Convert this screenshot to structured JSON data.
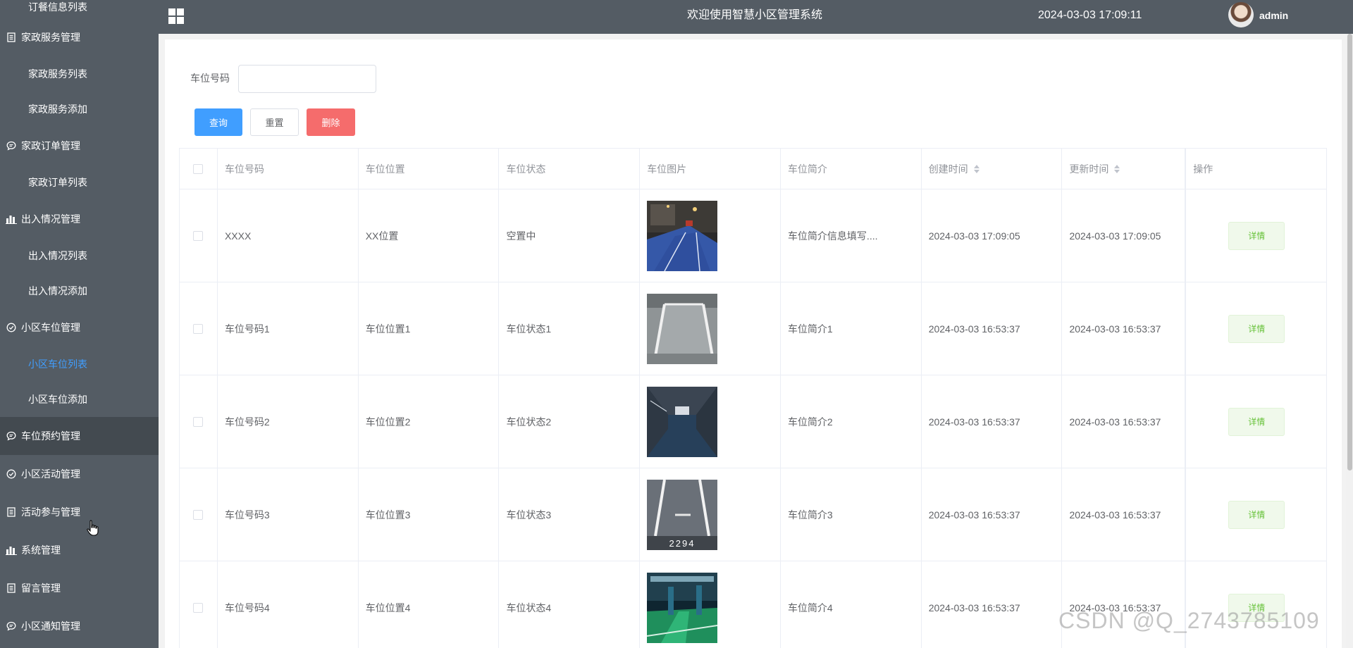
{
  "header": {
    "title": "欢迎使用智慧小区管理系统",
    "datetime": "2024-03-03 17:09:11",
    "username": "admin"
  },
  "sidebar": {
    "entries": [
      {
        "type": "item",
        "label": "订餐信息列表"
      },
      {
        "type": "group",
        "label": "家政服务管理",
        "icon": "document-icon"
      },
      {
        "type": "item",
        "label": "家政服务列表"
      },
      {
        "type": "item",
        "label": "家政服务添加"
      },
      {
        "type": "group",
        "label": "家政订单管理",
        "icon": "chat-icon"
      },
      {
        "type": "item",
        "label": "家政订单列表"
      },
      {
        "type": "group",
        "label": "出入情况管理",
        "icon": "bar-chart-icon"
      },
      {
        "type": "item",
        "label": "出入情况列表"
      },
      {
        "type": "item",
        "label": "出入情况添加"
      },
      {
        "type": "group",
        "label": "小区车位管理",
        "icon": "check-circle-icon"
      },
      {
        "type": "item",
        "label": "小区车位列表",
        "active": true
      },
      {
        "type": "item",
        "label": "小区车位添加"
      },
      {
        "type": "group",
        "label": "车位预约管理",
        "icon": "chat-icon",
        "highlight": true
      },
      {
        "type": "group",
        "label": "小区活动管理",
        "icon": "check-circle-icon"
      },
      {
        "type": "group",
        "label": "活动参与管理",
        "icon": "document-icon"
      },
      {
        "type": "group",
        "label": "系统管理",
        "icon": "bar-chart-icon"
      },
      {
        "type": "group",
        "label": "留言管理",
        "icon": "document-icon"
      },
      {
        "type": "group",
        "label": "小区通知管理",
        "icon": "chat-icon"
      }
    ]
  },
  "search": {
    "label": "车位号码",
    "value": "",
    "placeholder": ""
  },
  "buttons": {
    "query": "查询",
    "reset": "重置",
    "delete": "删除"
  },
  "table": {
    "columns": [
      "车位号码",
      "车位位置",
      "车位状态",
      "车位图片",
      "车位简介",
      "创建时间",
      "更新时间",
      "操作"
    ],
    "rows": [
      {
        "number": "XXXX",
        "location": "XX位置",
        "status": "空置中",
        "image": "parking-photo-1",
        "intro": "车位简介信息填写....",
        "created": "2024-03-03 17:09:05",
        "updated": "2024-03-03 17:09:05",
        "action": "详情"
      },
      {
        "number": "车位号码1",
        "location": "车位位置1",
        "status": "车位状态1",
        "image": "parking-photo-2",
        "intro": "车位简介1",
        "created": "2024-03-03 16:53:37",
        "updated": "2024-03-03 16:53:37",
        "action": "详情"
      },
      {
        "number": "车位号码2",
        "location": "车位位置2",
        "status": "车位状态2",
        "image": "parking-photo-3",
        "intro": "车位简介2",
        "created": "2024-03-03 16:53:37",
        "updated": "2024-03-03 16:53:37",
        "action": "详情"
      },
      {
        "number": "车位号码3",
        "location": "车位位置3",
        "status": "车位状态3",
        "image": "parking-photo-4",
        "intro": "车位简介3",
        "created": "2024-03-03 16:53:37",
        "updated": "2024-03-03 16:53:37",
        "action": "详情"
      },
      {
        "number": "车位号码4",
        "location": "车位位置4",
        "status": "车位状态4",
        "image": "parking-photo-5",
        "intro": "车位简介4",
        "created": "2024-03-03 16:53:37",
        "updated": "2024-03-03 16:53:37",
        "action": "详情"
      }
    ],
    "photo_texts": [
      "2294"
    ]
  },
  "watermark": "CSDN @Q_2743785109",
  "colors": {
    "sidebar_bg": "#545c64",
    "header_bg": "#545c64",
    "active_menu": "#409eff",
    "primary": "#409eff",
    "danger": "#f56c6c",
    "success_text": "#67c23a",
    "success_bg": "#f0f9eb"
  }
}
